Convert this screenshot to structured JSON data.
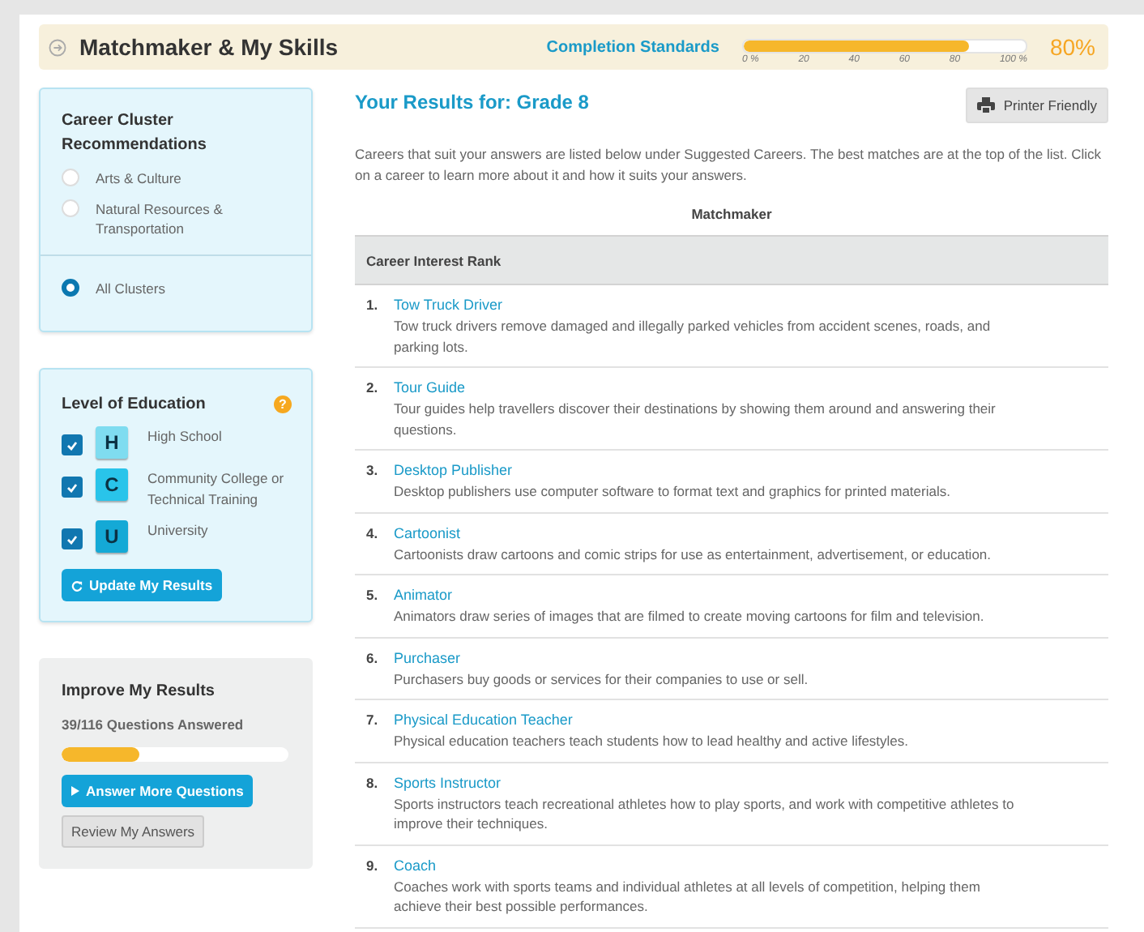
{
  "header": {
    "title": "Matchmaker & My Skills",
    "standards_label": "Completion Standards",
    "completion": {
      "level": 0.8,
      "ticks": [
        "0 %",
        "20",
        "40",
        "60",
        "80",
        "100 %"
      ],
      "reading": "80%"
    }
  },
  "cluster_panel": {
    "title": "Career Cluster Recommendations",
    "options": [
      {
        "label": "Arts & Culture",
        "selected": false
      },
      {
        "label": "Natural Resources & Transportation",
        "selected": false
      }
    ],
    "all_option": {
      "label": "All Clusters",
      "selected": true
    }
  },
  "education_panel": {
    "title": "Level of Education",
    "help": "?",
    "levels": [
      {
        "letter": "H",
        "label": "High School",
        "checked": true,
        "color": "#7fdcf0"
      },
      {
        "letter": "C",
        "label": "Community College or Technical Training",
        "checked": true,
        "color": "#29c4ea"
      },
      {
        "letter": "U",
        "label": "University",
        "checked": true,
        "color": "#14a9d6"
      }
    ],
    "button": "Update My Results"
  },
  "improve_panel": {
    "title": "Improve My Results",
    "progress_text": "39/116 Questions Answered",
    "level": 0.34,
    "primary_button": "Answer More Questions",
    "secondary_button": "Review My Answers"
  },
  "results": {
    "title": "Your Results for: Grade 8",
    "print_button": "Printer Friendly",
    "intro": "Careers that suit your answers are listed below under Suggested Careers. The best matches are at the top of the list. Click on a career to learn more about it and how it suits your answers.",
    "table_caption": "Matchmaker",
    "column_header": "Career Interest Rank",
    "careers": [
      {
        "rank": "1.",
        "name": "Tow Truck Driver",
        "description": "Tow truck drivers remove damaged and illegally parked vehicles from accident scenes, roads, and parking lots."
      },
      {
        "rank": "2.",
        "name": "Tour Guide",
        "description": "Tour guides help travellers discover their destinations by showing them around and answering their questions."
      },
      {
        "rank": "3.",
        "name": "Desktop Publisher",
        "description": "Desktop publishers use computer software to format text and graphics for printed materials."
      },
      {
        "rank": "4.",
        "name": "Cartoonist",
        "description": "Cartoonists draw cartoons and comic strips for use as entertainment, advertisement, or education."
      },
      {
        "rank": "5.",
        "name": "Animator",
        "description": "Animators draw series of images that are filmed to create moving cartoons for film and television."
      },
      {
        "rank": "6.",
        "name": "Purchaser",
        "description": "Purchasers buy goods or services for their companies to use or sell."
      },
      {
        "rank": "7.",
        "name": "Physical Education Teacher",
        "description": "Physical education teachers teach students how to lead healthy and active lifestyles."
      },
      {
        "rank": "8.",
        "name": "Sports Instructor",
        "description": "Sports instructors teach recreational athletes how to play sports, and work with competitive athletes to improve their techniques."
      },
      {
        "rank": "9.",
        "name": "Coach",
        "description": "Coaches work with sports teams and individual athletes at all levels of competition, helping them achieve their best possible performances."
      }
    ]
  }
}
